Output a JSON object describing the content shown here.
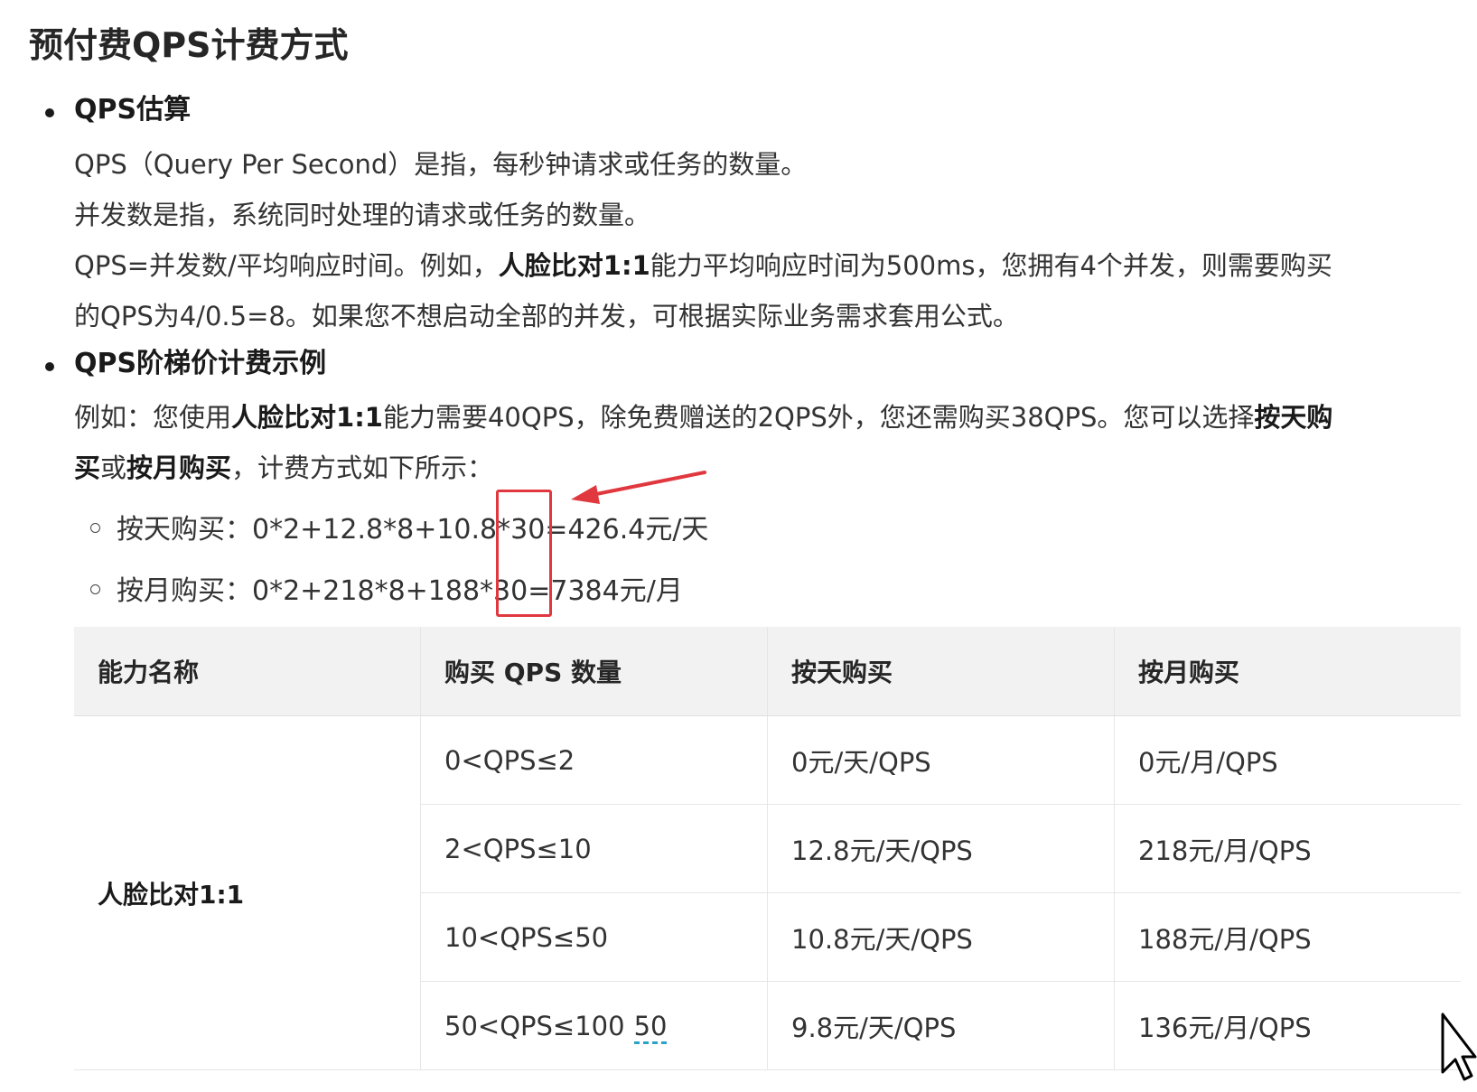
{
  "title": "预付费QPS计费方式",
  "section1": {
    "heading": "QPS估算",
    "line1": "QPS（Query Per Second）是指，每秒钟请求或任务的数量。",
    "line2": "并发数是指，系统同时处理的请求或任务的数量。",
    "line3_a": "QPS=并发数/平均响应时间。例如，",
    "line3_bold": "人脸比对1:1",
    "line3_b": "能力平均响应时间为500ms，您拥有4个并发，则需要购买",
    "line4": "的QPS为4/0.5=8。如果您不想启动全部的并发，可根据实际业务需求套用公式。"
  },
  "section2": {
    "heading": "QPS阶梯价计费示例",
    "p_a": "例如：您使用",
    "p_bold1": "人脸比对1:1",
    "p_b": "能力需要40QPS，除免费赠送的2QPS外，您还需购买38QPS。您可以选择",
    "p_bold2": "按天购",
    "p_bold3": "买",
    "p_c": "或",
    "p_bold4": "按月购买",
    "p_d": "，计费方式如下所示：",
    "daily": "按天购买：0*2+12.8*8+10.8*30=426.4元/天",
    "monthly": "按月购买：0*2+218*8+188*30=7384元/月"
  },
  "table": {
    "headers": [
      "能力名称",
      "购买 QPS 数量",
      "按天购买",
      "按月购买"
    ],
    "ability": "人脸比对1:1",
    "rows": [
      {
        "qps": "0<QPS≤2",
        "daily": "0元/天/QPS",
        "monthly": "0元/月/QPS"
      },
      {
        "qps": "2<QPS≤10",
        "daily": "12.8元/天/QPS",
        "monthly": "218元/月/QPS"
      },
      {
        "qps": "10<QPS≤50",
        "daily": "10.8元/天/QPS",
        "monthly": "188元/月/QPS"
      },
      {
        "qps": "50<QPS≤100",
        "qps_extra": "50",
        "daily": "9.8元/天/QPS",
        "monthly": "136元/月/QPS"
      }
    ]
  },
  "colors": {
    "annotation": "#e0383e",
    "header_bg": "#f2f2f2",
    "spellcheck_underline": "#2aa3c9"
  }
}
